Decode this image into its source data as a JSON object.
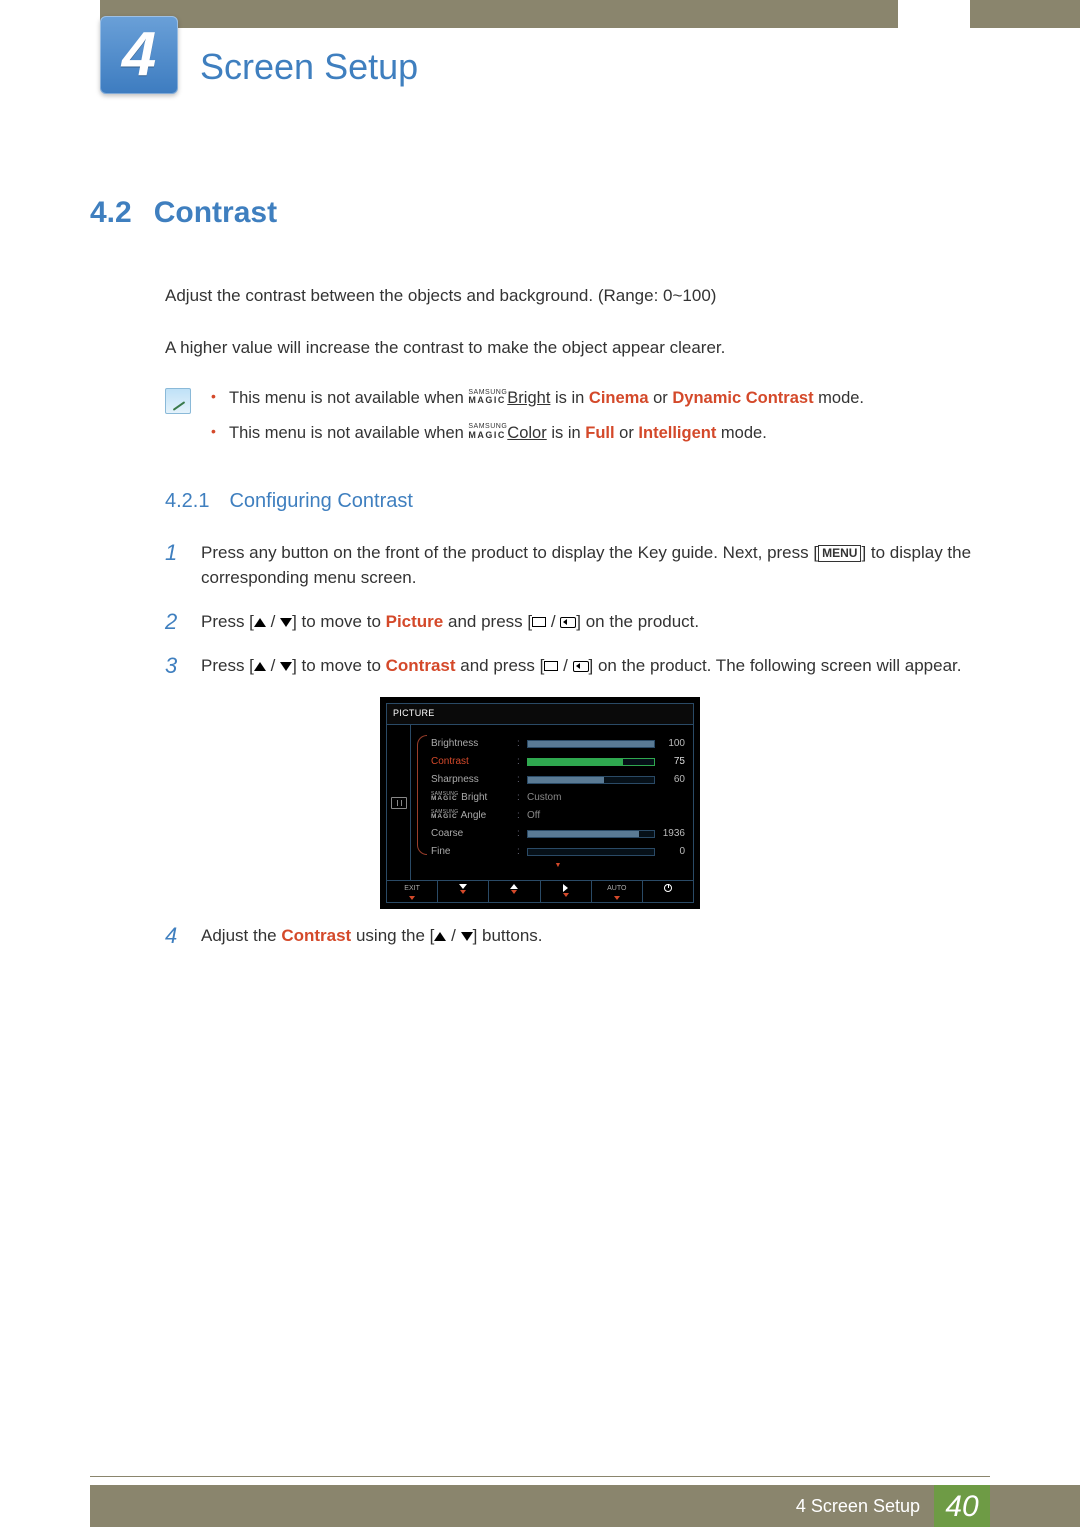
{
  "chapter": {
    "number": "4",
    "title": "Screen Setup"
  },
  "section": {
    "number": "4.2",
    "title": "Contrast"
  },
  "intro": {
    "p1": "Adjust the contrast between the objects and background. (Range: 0~100)",
    "p2": "A higher value will increase the contrast to make the object appear clearer."
  },
  "magic": {
    "line1": "SAMSUNG",
    "line2": "MAGIC"
  },
  "notes": {
    "n1": {
      "pre": "This menu is not available when ",
      "link": "Bright",
      "mid": " is in ",
      "kw1": "Cinema",
      "or": " or ",
      "kw2": "Dynamic Contrast",
      "post": " mode."
    },
    "n2": {
      "pre": "This menu is not available when ",
      "link": "Color",
      "mid": " is in ",
      "kw1": "Full",
      "or": " or ",
      "kw2": "Intelligent",
      "post": " mode."
    }
  },
  "subsection": {
    "number": "4.2.1",
    "title": "Configuring Contrast"
  },
  "steps": {
    "s1": {
      "num": "1",
      "a": "Press any button on the front of the product to display the Key guide. Next, press [",
      "menu": "MENU",
      "b": "] to display the corresponding menu screen."
    },
    "s2": {
      "num": "2",
      "a": "Press [",
      "b": "] to move to ",
      "kw": "Picture",
      "c": " and press [",
      "d": "] on the product."
    },
    "s3": {
      "num": "3",
      "a": "Press [",
      "b": "] to move to ",
      "kw": "Contrast",
      "c": " and press [",
      "d": "] on the product. The following screen will appear."
    },
    "s4": {
      "num": "4",
      "a": "Adjust the ",
      "kw": "Contrast",
      "b": " using the [",
      "c": "] buttons."
    }
  },
  "osd": {
    "title": "PICTURE",
    "rows": {
      "brightness": {
        "label": "Brightness",
        "value": "100",
        "fill": 100
      },
      "contrast": {
        "label": "Contrast",
        "value": "75",
        "fill": 75
      },
      "sharpness": {
        "label": "Sharpness",
        "value": "60",
        "fill": 60
      },
      "magic_bright": {
        "suffix": "Bright",
        "text": "Custom"
      },
      "magic_angle": {
        "suffix": "Angle",
        "text": "Off"
      },
      "coarse": {
        "label": "Coarse",
        "value": "1936",
        "fill": 88
      },
      "fine": {
        "label": "Fine",
        "value": "0",
        "fill": 0
      }
    },
    "footer": {
      "exit": "EXIT",
      "auto": "AUTO"
    }
  },
  "footer": {
    "chapter_label": "4 Screen Setup",
    "page": "40"
  }
}
